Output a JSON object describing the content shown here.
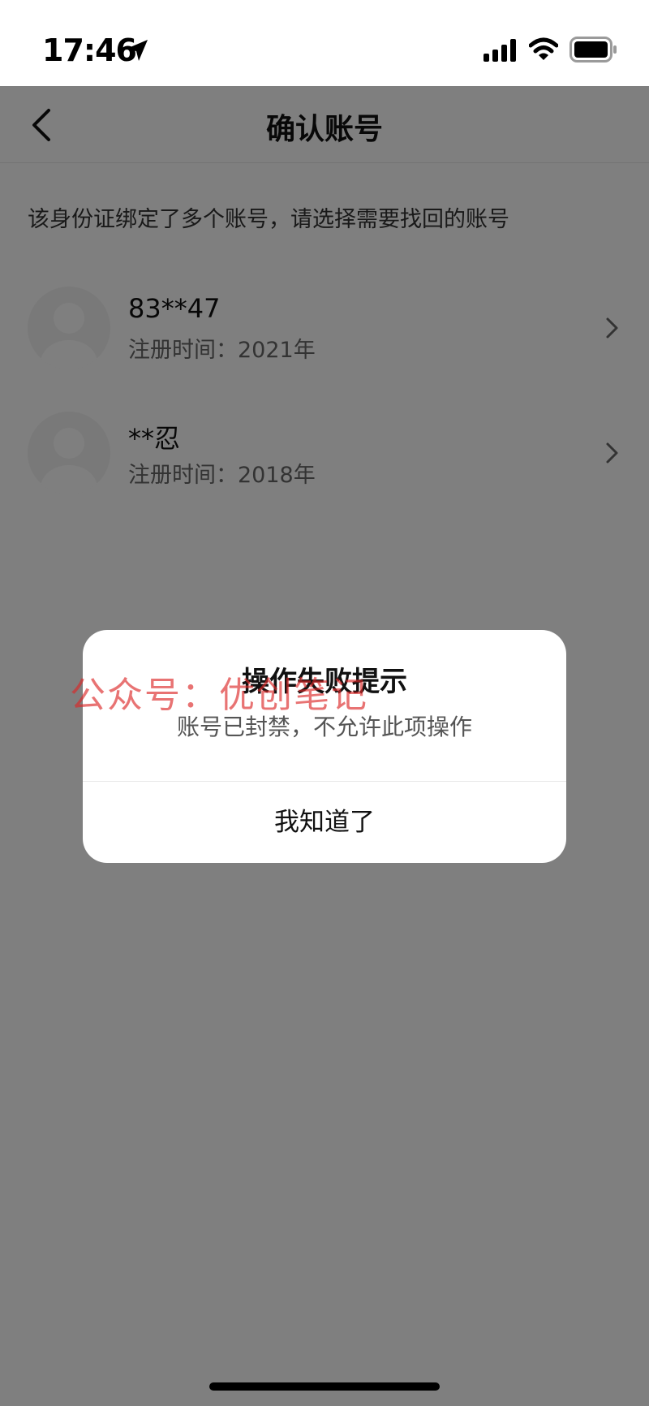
{
  "status_bar": {
    "time": "17:46",
    "icons": [
      "location-arrow-icon",
      "signal-icon",
      "wifi-icon",
      "battery-icon"
    ]
  },
  "nav": {
    "back_icon": "chevron-left-icon",
    "title": "确认账号"
  },
  "hint": "该身份证绑定了多个账号，请选择需要找回的账号",
  "accounts": [
    {
      "name": "83**47",
      "registered": "注册时间：2021年"
    },
    {
      "name": "**忍",
      "registered": "注册时间：2018年"
    }
  ],
  "dialog": {
    "title": "操作失败提示",
    "message": "账号已封禁，不允许此项操作",
    "button": "我知道了"
  },
  "watermark": "公众号：优创笔记",
  "colors": {
    "overlay": "rgba(0,0,0,0.5)",
    "watermark": "#dc2828"
  }
}
